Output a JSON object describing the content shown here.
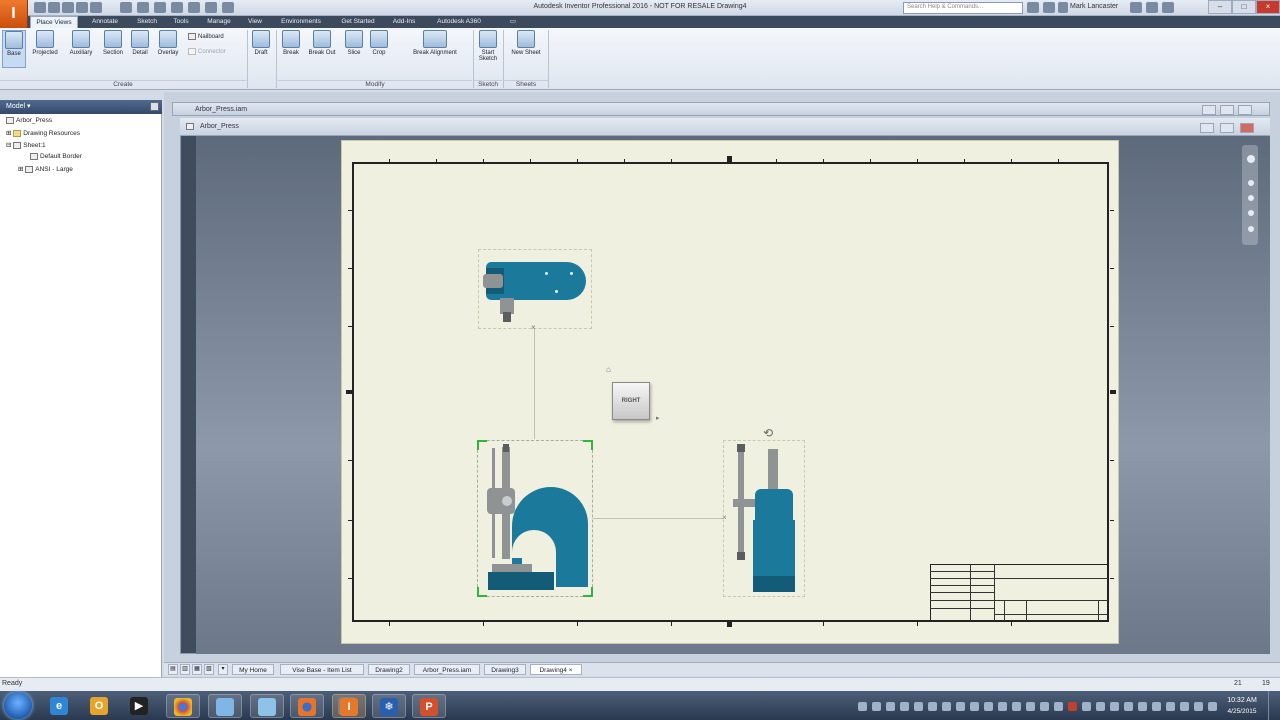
{
  "window": {
    "title": "Autodesk Inventor Professional 2016 - NOT FOR RESALE   Drawing4",
    "help_search_placeholder": "Search Help & Commands...",
    "user": "Mark Lancaster",
    "app_logo": "I"
  },
  "ribbon_tabs": [
    "Place Views",
    "Annotate",
    "Sketch",
    "Tools",
    "Manage",
    "View",
    "Environments",
    "Get Started",
    "Add-Ins",
    "Autodesk A360"
  ],
  "ribbon": {
    "create": {
      "label": "Create",
      "base": "Base",
      "projected": "Projected",
      "auxiliary": "Auxiliary",
      "section": "Section",
      "detail": "Detail",
      "overlay": "Overlay",
      "nailboard": "Nailboard",
      "connector": "Connector"
    },
    "modify": {
      "label": "Modify",
      "draft": "Draft",
      "break": "Break",
      "break_out": "Break Out",
      "slice": "Slice",
      "crop": "Crop",
      "break_alignment": "Break Alignment"
    },
    "sketch": {
      "label": "Sketch",
      "start_sketch_1": "Start",
      "start_sketch_2": "Sketch"
    },
    "sheets": {
      "label": "Sheets",
      "new_sheet": "New Sheet"
    }
  },
  "browser": {
    "title": "Model",
    "items": [
      "Arbor_Press",
      "Drawing Resources",
      "Sheet:1",
      "Default Border",
      "ANSI - Large"
    ]
  },
  "documents": {
    "back_title": "Arbor_Press.iam",
    "front_title": "Arbor_Press"
  },
  "viewcube": {
    "face": "RIGHT"
  },
  "doc_tabs": [
    "My Home",
    "Vise Base - Item List",
    "Drawing2",
    "Arbor_Press.iam",
    "Drawing3",
    "Drawing4"
  ],
  "status": {
    "text": "Ready",
    "num1": "21",
    "num2": "19"
  },
  "clock": {
    "time": "10:32 AM",
    "date": "4/25/2015"
  },
  "colors": {
    "part_blue": "#1b7a9c",
    "sheet": "#eff0df",
    "select_green": "#33b53a"
  }
}
